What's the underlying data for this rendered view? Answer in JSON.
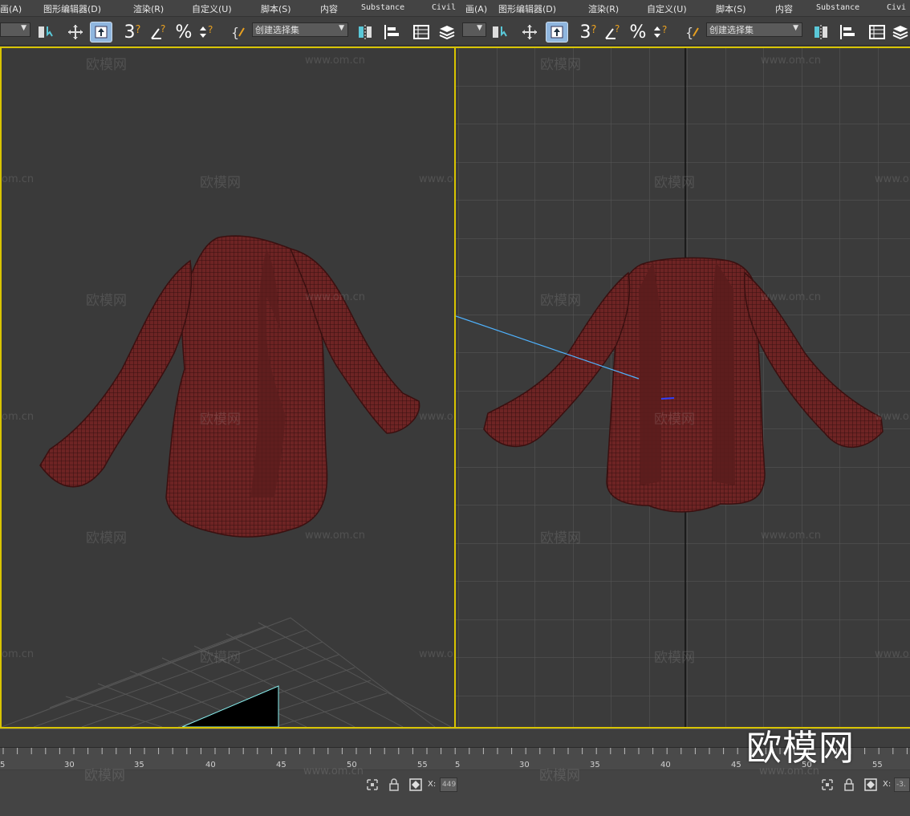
{
  "menubar": {
    "items": [
      "画(A)",
      "图形编辑器(D)",
      "渲染(R)",
      "自定义(U)",
      "脚本(S)",
      "内容",
      "Substance",
      "Civil",
      "画(A)",
      "图形编辑器(D)",
      "渲染(R)",
      "自定义(U)",
      "脚本(S)",
      "内容",
      "Substance",
      "Civi"
    ]
  },
  "toolbar": {
    "left_selection_set": "创建选择集",
    "right_selection_set": "创建选择集",
    "snap_label": "3",
    "percent_label": "%"
  },
  "viewports": {
    "watermark_text": "欧模网",
    "watermark_url": "www.om.cn",
    "partial_url": "om.cn"
  },
  "timeline": {
    "left_ticks": [
      "5",
      "30",
      "35",
      "40",
      "45",
      "50",
      "55"
    ],
    "right_ticks": [
      "5",
      "30",
      "35",
      "40",
      "45",
      "50",
      "55"
    ]
  },
  "status": {
    "x_label": "X:",
    "left_x_value": "449",
    "right_x_value": "-3."
  },
  "brand": {
    "logo_text": "欧模网"
  },
  "colors": {
    "viewport_border": "#d8c400",
    "mesh": "#7a2a2a",
    "active_button": "#8fb6df"
  }
}
